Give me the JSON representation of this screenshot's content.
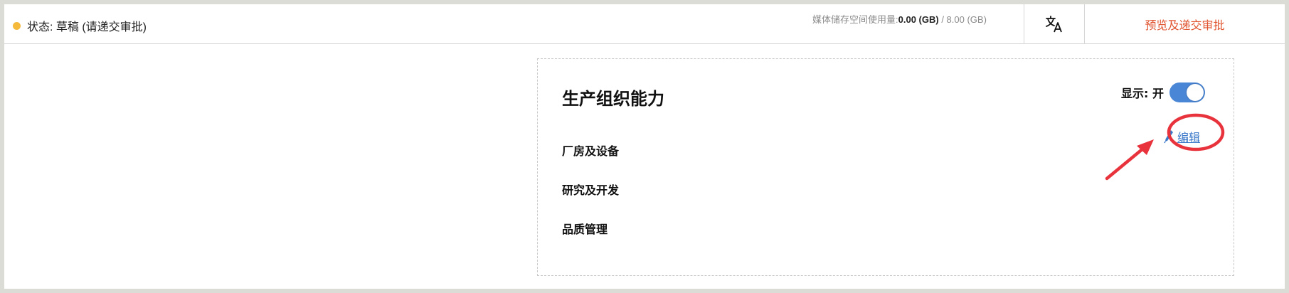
{
  "header": {
    "status_text": "状态: 草稿 (请递交审批)",
    "storage_label": "媒体储存空间使用量:",
    "storage_used": "0.00 (GB)",
    "storage_total": " / 8.00 (GB)",
    "translate_icon": "translate-icon",
    "submit_label": "预览及递交审批"
  },
  "card": {
    "title": "生产组织能力",
    "display_label": "显示: 开",
    "display_on": true,
    "edit_label": "编辑",
    "sections": [
      "厂房及设备",
      "研究及开发",
      "品质管理"
    ]
  },
  "colors": {
    "status_dot": "#f5b93c",
    "submit": "#e0532e",
    "toggle": "#4a86d6",
    "link": "#3a78c9",
    "annotation": "#e8323c"
  }
}
